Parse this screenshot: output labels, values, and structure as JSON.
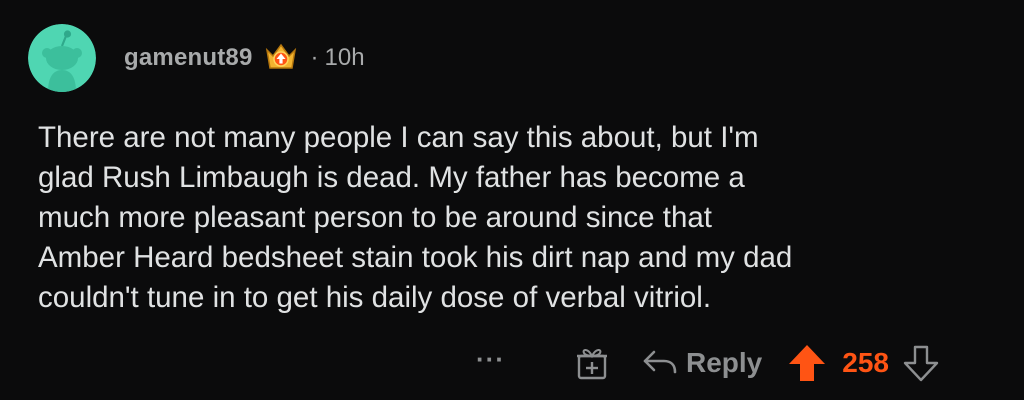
{
  "comment": {
    "username": "gamenut89",
    "separator": "·",
    "timestamp": "10h",
    "body": "There are not many people I can say this about, but I'm\nglad Rush Limbaugh is dead. My father has become a\nmuch more pleasant person to be around since that\nAmber Heard bedsheet stain took his dirt nap and my dad\ncouldn't tune in to get his daily dose of verbal vitriol.",
    "avatar_color": "#4fd6b2",
    "flair_icon": "crown-badge-icon"
  },
  "actions": {
    "more_label": "···",
    "award_icon": "award-gift-icon",
    "reply_label": "Reply",
    "reply_icon": "reply-arrow-icon",
    "upvote_icon": "upvote-arrow-icon",
    "score": "258",
    "downvote_icon": "downvote-arrow-icon",
    "upvoted": true,
    "accent_color": "#ff5414",
    "muted_color": "#8d8f91"
  }
}
